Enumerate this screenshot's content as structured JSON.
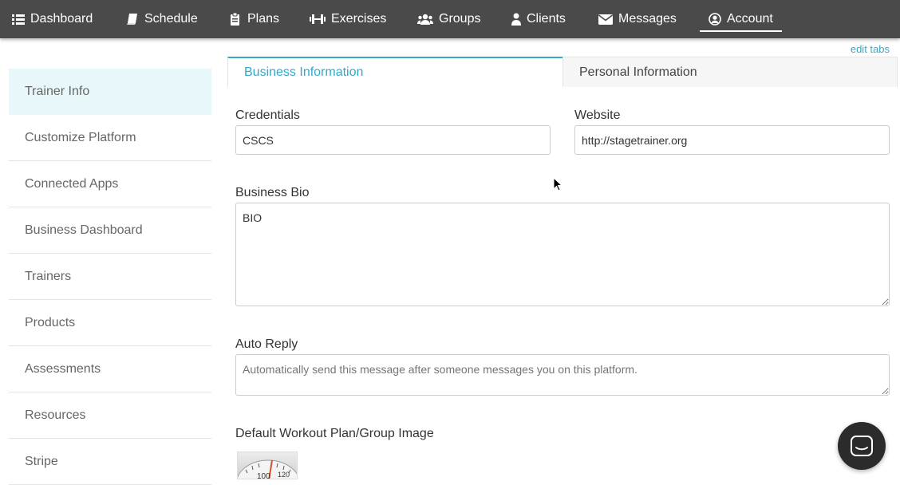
{
  "nav": [
    {
      "label": "Dashboard",
      "icon": "list-icon"
    },
    {
      "label": "Schedule",
      "icon": "book-icon"
    },
    {
      "label": "Plans",
      "icon": "clipboard-icon"
    },
    {
      "label": "Exercises",
      "icon": "dumbbell-icon"
    },
    {
      "label": "Groups",
      "icon": "users-icon"
    },
    {
      "label": "Clients",
      "icon": "user-icon"
    },
    {
      "label": "Messages",
      "icon": "envelope-icon"
    },
    {
      "label": "Account",
      "icon": "account-circle-icon",
      "active": true
    }
  ],
  "edit_tabs": "edit tabs",
  "sidebar": {
    "items": [
      {
        "label": "Trainer Info",
        "active": true
      },
      {
        "label": "Customize Platform"
      },
      {
        "label": "Connected Apps"
      },
      {
        "label": "Business Dashboard"
      },
      {
        "label": "Trainers"
      },
      {
        "label": "Products"
      },
      {
        "label": "Assessments"
      },
      {
        "label": "Resources"
      },
      {
        "label": "Stripe"
      }
    ]
  },
  "tabs": [
    {
      "label": "Business Information",
      "active": true
    },
    {
      "label": "Personal Information"
    }
  ],
  "form": {
    "credentials": {
      "label": "Credentials",
      "value": "CSCS"
    },
    "website": {
      "label": "Website",
      "value": "http://stagetrainer.org"
    },
    "bio": {
      "label": "Business Bio",
      "value": "BIO"
    },
    "auto_reply": {
      "label": "Auto Reply",
      "placeholder": "Automatically send this message after someone messages you on this platform."
    },
    "default_image": {
      "label": "Default Workout Plan/Group Image",
      "scale_marks": [
        "100",
        "120"
      ]
    }
  },
  "colors": {
    "accent": "#35a8c8",
    "nav_bg": "#4a4a4a",
    "sidebar_active": "#e7f7fa"
  }
}
